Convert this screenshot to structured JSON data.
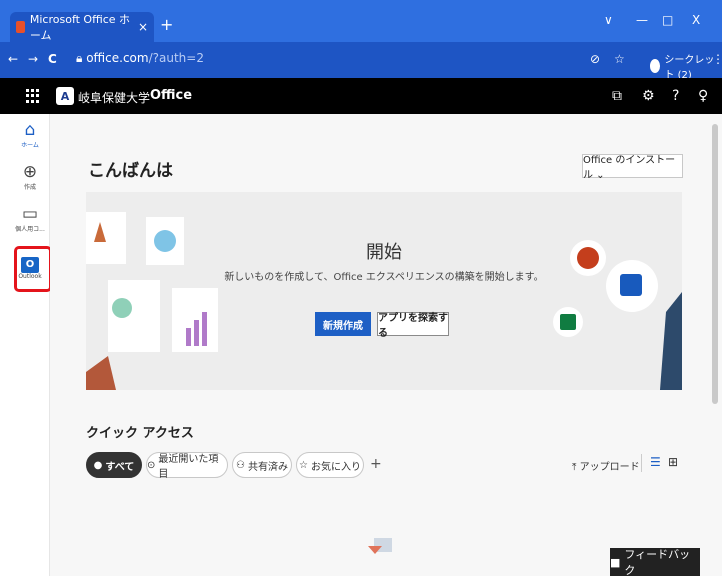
{
  "browser": {
    "tab_title": "Microsoft Office ホーム",
    "tab_close": "×",
    "new_tab": "+",
    "window_controls": {
      "chevron": "∨",
      "minimize": "—",
      "maximize": "□",
      "close": "X"
    },
    "nav": {
      "back": "←",
      "forward": "→",
      "reload": "C"
    },
    "url_host": "office.com",
    "url_path": "/?auth=2",
    "incognito_label": "シークレット (2)",
    "menu": "⋮"
  },
  "header": {
    "logo_text": "A",
    "org_name": "岐阜保健大学",
    "app_name": "Office",
    "icons": [
      "feedback-icon",
      "settings-icon",
      "help-icon",
      "account-icon"
    ]
  },
  "rail": {
    "home": "ホーム",
    "create": "作成",
    "my_content": "個人用コ...",
    "outlook": "Outlook"
  },
  "main": {
    "greeting": "こんばんは",
    "install_label": "Office のインストール ⌄",
    "hero": {
      "title": "開始",
      "subtitle": "新しいものを作成して、Office エクスペリエンスの構築を開始します。",
      "primary_button": "新規作成",
      "secondary_button": "アプリを探索する"
    },
    "quick_access": {
      "title": "クイック アクセス",
      "chips": [
        {
          "label": "すべて",
          "icon": "●"
        },
        {
          "label": "最近開いた項目",
          "icon": "⊙"
        },
        {
          "label": "共有済み",
          "icon": "⚇"
        },
        {
          "label": "お気に入り",
          "icon": "☆"
        }
      ],
      "add": "+",
      "upload": "アップロード",
      "upload_icon": "⤒",
      "list_view_icon": "☰",
      "grid_view_icon": "⊞"
    },
    "feedback": "フィードバック"
  },
  "colors": {
    "accent": "#1d5fc5",
    "tab_bar": "#2f6fe0",
    "address_bar": "#1e55c4",
    "highlight": "#e4141b"
  }
}
